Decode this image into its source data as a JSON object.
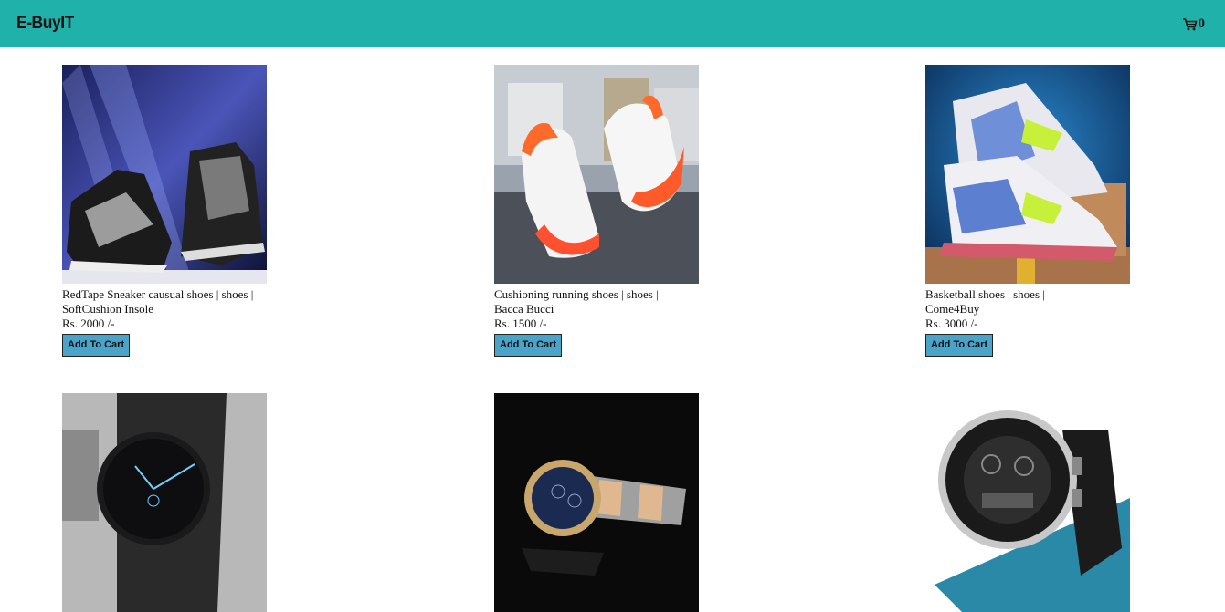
{
  "navbar": {
    "brand": "E-BuyIT",
    "cart_icon": "cart-icon",
    "cart_count": "0",
    "background": "#20b2aa"
  },
  "button_color": "#4aa3c8",
  "products": [
    {
      "title": "RedTape Sneaker causual shoes | shoes |",
      "brand": "SoftCushion Insole",
      "price": "Rs. 2000 /-",
      "button": "Add To Cart",
      "image": "sneaker-image"
    },
    {
      "title": "Cushioning running shoes | shoes |",
      "brand": "Bacca Bucci",
      "price": "Rs. 1500 /-",
      "button": "Add To Cart",
      "image": "running-shoes-image"
    },
    {
      "title": "Basketball shoes | shoes |",
      "brand": "Come4Buy",
      "price": "Rs. 3000 /-",
      "button": "Add To Cart",
      "image": "basketball-shoes-image"
    },
    {
      "image": "mesh-watch-image"
    },
    {
      "image": "steel-watch-image"
    },
    {
      "image": "sport-watch-image"
    }
  ]
}
